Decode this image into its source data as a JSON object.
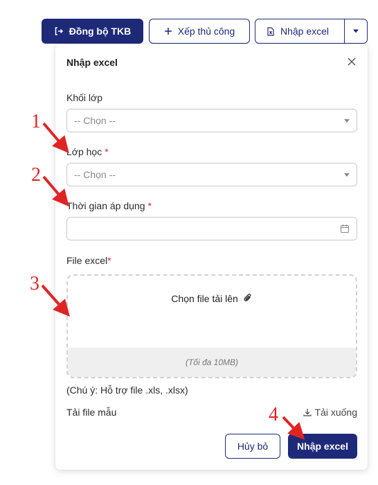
{
  "toolbar": {
    "sync_label": "Đồng bộ TKB",
    "manual_label": "Xếp thủ công",
    "import_label": "Nhập excel"
  },
  "dialog": {
    "title": "Nhập excel",
    "grade": {
      "label": "Khối lớp",
      "placeholder": "-- Chọn --"
    },
    "class": {
      "label": "Lớp học",
      "required": "*",
      "placeholder": "-- Chọn --"
    },
    "apply_time": {
      "label": "Thời gian áp dụng",
      "required": "*",
      "value": ""
    },
    "file": {
      "label": "File excel",
      "required": "*",
      "upload_text": "Chọn file tải lên",
      "limit_text": "(Tối đa 10MB)"
    },
    "note": "(Chú ý: Hỗ trợ file .xls, .xlsx)",
    "template_label": "Tải file mẫu",
    "download_label": "Tải xuống",
    "cancel_label": "Hủy bỏ",
    "submit_label": "Nhập excel"
  },
  "annotations": [
    "1",
    "2",
    "3",
    "4"
  ],
  "colors": {
    "primary": "#1e2a78",
    "required": "#e02424",
    "annotation": "#e02424"
  }
}
